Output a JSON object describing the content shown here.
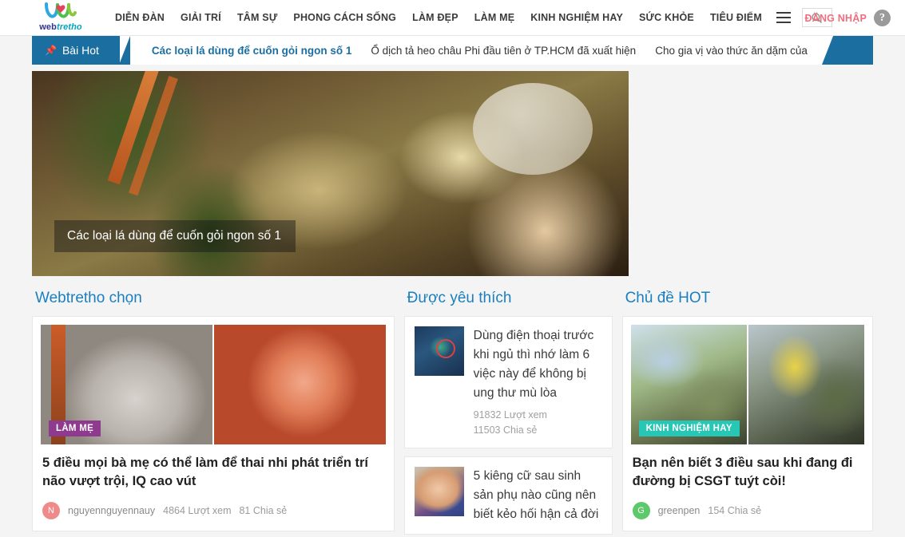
{
  "site": {
    "logo_word_1": "web",
    "logo_word_2": "tretho"
  },
  "header": {
    "nav": [
      {
        "label": "DIỄN ĐÀN"
      },
      {
        "label": "GIẢI TRÍ"
      },
      {
        "label": "TÂM SỰ"
      },
      {
        "label": "PHONG CÁCH SỐNG"
      },
      {
        "label": "LÀM ĐẸP"
      },
      {
        "label": "LÀM MẸ"
      },
      {
        "label": "KINH NGHIỆM HAY"
      },
      {
        "label": "SỨC KHỎE"
      },
      {
        "label": "TIÊU ĐIỂM"
      }
    ],
    "menu_icon": "hamburger-icon",
    "search_icon": "search-icon",
    "login_label": "ĐĂNG NHẬP",
    "help_icon_label": "?",
    "login_color": "#ef6e7c"
  },
  "hotbar": {
    "tab_label": "Bài Hot",
    "pin_icon": "pin-icon",
    "accent_color": "#1b6fa0",
    "items": [
      {
        "label": "Các loại lá dùng để cuốn gỏi ngon số 1",
        "active": true
      },
      {
        "label": "Ổ dịch tả heo châu Phi đầu tiên ở TP.HCM đã xuất hiện",
        "active": false
      },
      {
        "label": "Cho gia vị vào thức ăn dặm của",
        "active": false
      }
    ]
  },
  "hero": {
    "caption": "Các loại lá dùng để cuốn gỏi ngon số 1"
  },
  "columns": {
    "left": {
      "title": "Webtretho chọn",
      "card": {
        "badge": "LÀM MẸ",
        "title": "5 điều mọi bà mẹ có thể làm để thai nhi phát triển trí não vượt trội, IQ cao vút",
        "avatar_letter": "N",
        "author": "nguyennguyennauy",
        "views": "4864 Lượt xem",
        "shares": "81 Chia sẻ"
      }
    },
    "middle": {
      "title": "Được yêu thích",
      "items": [
        {
          "title": "Dùng điện thoại trước khi ngủ thì nhớ làm 6 việc này để không bị ung thư mù lòa",
          "views": "91832 Lượt xem",
          "shares": "11503 Chia sẻ"
        },
        {
          "title": "5 kiêng cữ sau sinh sản phụ nào cũng nên biết kẻo hối hận cả đời",
          "views": "",
          "shares": ""
        }
      ]
    },
    "right": {
      "title": "Chủ đề HOT",
      "card": {
        "badge": "KINH NGHIỆM HAY",
        "title": "Bạn nên biết 3 điều sau khi đang đi đường bị CSGT tuýt còi!",
        "avatar_letter": "G",
        "author": "greenpen",
        "shares": "154 Chia sẻ"
      }
    }
  }
}
